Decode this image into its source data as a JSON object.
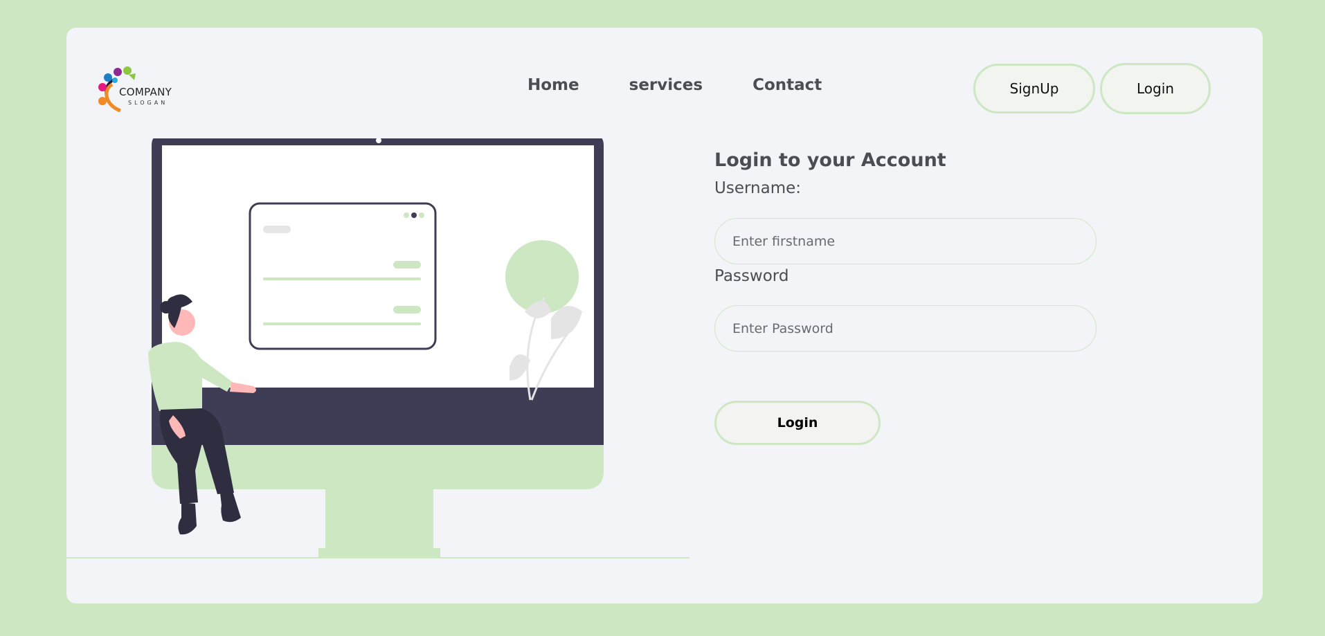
{
  "logo": {
    "company": "COMPANY",
    "slogan": "SLOGAN",
    "icon": "company-logo"
  },
  "nav": {
    "home": "Home",
    "services": "services",
    "contact": "Contact"
  },
  "auth": {
    "signup": "SignUp",
    "login": "Login"
  },
  "form": {
    "title": "Login to your Account",
    "username_label": "Username:",
    "username_placeholder": "Enter firstname",
    "password_label": "Password",
    "password_placeholder": "Enter Password",
    "submit": "Login"
  },
  "colors": {
    "accent": "#cde7c3",
    "card": "#f2f4f7",
    "text": "#4a4d52",
    "dark": "#3f3d56"
  }
}
